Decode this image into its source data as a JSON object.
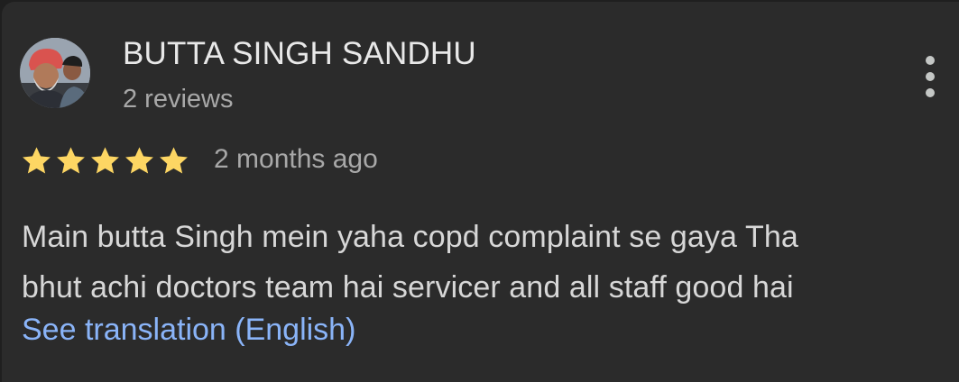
{
  "review": {
    "reviewer_name": "BUTTA SINGH SANDHU",
    "review_count": "2 reviews",
    "rating": 5,
    "rating_max": 5,
    "time_ago": "2 months ago",
    "text_lines": [
      "Main butta Singh mein yaha copd complaint se gaya Tha",
      "bhut achi doctors team hai servicer and all staff good hai"
    ],
    "translation_link": "See translation (English)"
  },
  "icons": {
    "more": "more-vert-icon",
    "star": "star-icon"
  },
  "colors": {
    "background": "#2b2b2b",
    "star": "#fdd663",
    "link": "#8ab4f8",
    "primary_text": "#e3e3e3",
    "secondary_text": "#a8a8a8"
  }
}
